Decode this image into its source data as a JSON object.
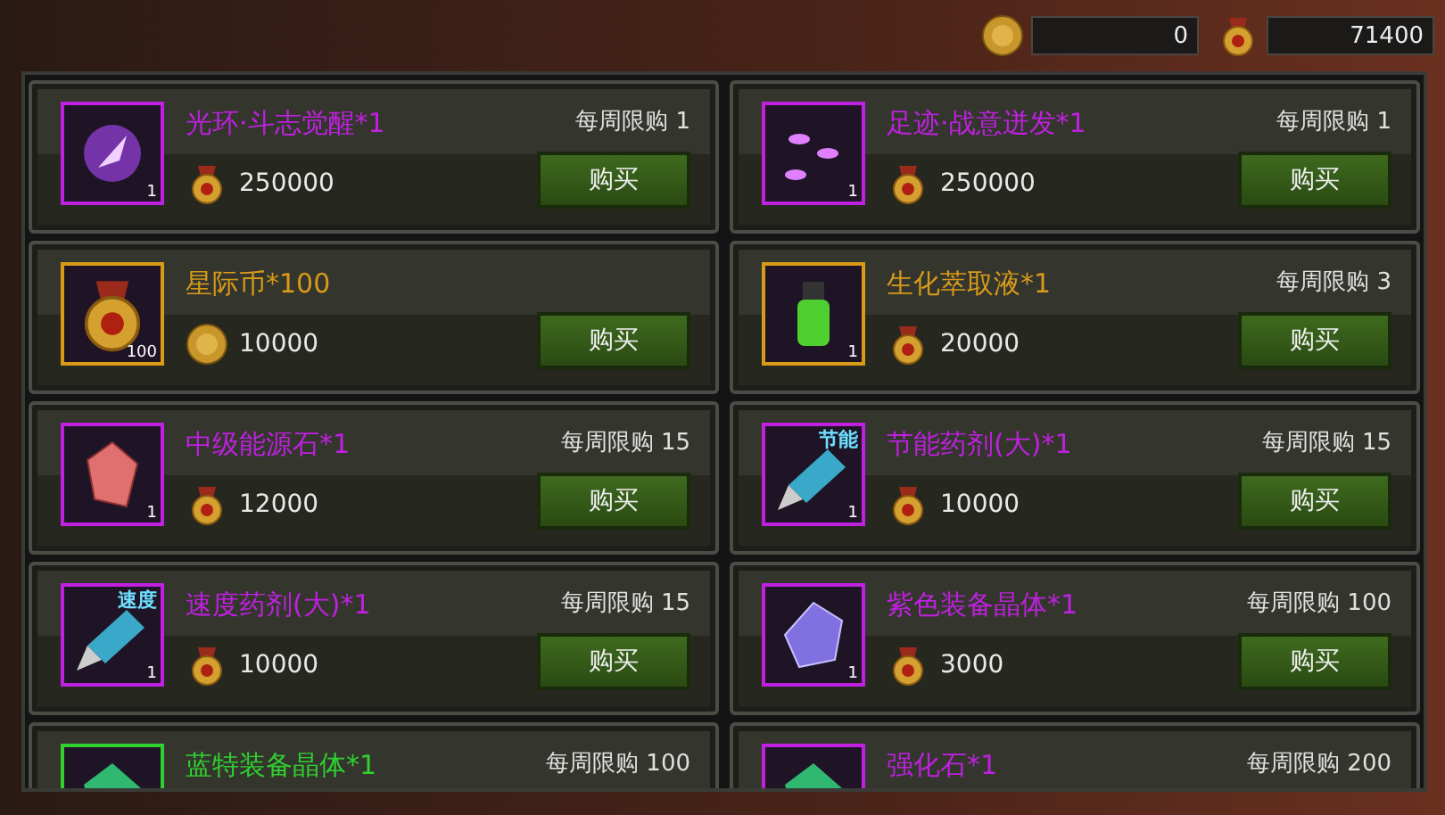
{
  "currencies": [
    {
      "kind": "coin",
      "value": "0"
    },
    {
      "kind": "medal",
      "value": "71400"
    }
  ],
  "items": [
    {
      "name": "光环·斗志觉醒*1",
      "color": "#c020e0",
      "kind": "aura",
      "qty": "1",
      "limit": "每周限购 1",
      "price": {
        "kind": "medal",
        "amount": "250000"
      },
      "button": "购买"
    },
    {
      "name": "足迹·战意迸发*1",
      "color": "#c020e0",
      "kind": "footprint",
      "qty": "1",
      "limit": "每周限购 1",
      "price": {
        "kind": "medal",
        "amount": "250000"
      },
      "button": "购买"
    },
    {
      "name": "星际币*100",
      "color": "#d89a18",
      "kind": "medal",
      "qty": "100",
      "price": {
        "kind": "coin",
        "amount": "10000"
      },
      "button": "购买"
    },
    {
      "name": "生化萃取液*1",
      "color": "#d89a18",
      "kind": "vial",
      "qty": "1",
      "limit": "每周限购 3",
      "price": {
        "kind": "medal",
        "amount": "20000"
      },
      "button": "购买"
    },
    {
      "name": "中级能源石*1",
      "color": "#c020e0",
      "kind": "redgem",
      "qty": "1",
      "limit": "每周限购 15",
      "price": {
        "kind": "medal",
        "amount": "12000"
      },
      "button": "购买"
    },
    {
      "name": "节能药剂(大)*1",
      "color": "#c020e0",
      "kind": "syringe",
      "icon_label": "节能",
      "qty": "1",
      "limit": "每周限购 15",
      "price": {
        "kind": "medal",
        "amount": "10000"
      },
      "button": "购买"
    },
    {
      "name": "速度药剂(大)*1",
      "color": "#c020e0",
      "kind": "syringe",
      "icon_label": "速度",
      "qty": "1",
      "limit": "每周限购 15",
      "price": {
        "kind": "medal",
        "amount": "10000"
      },
      "button": "购买"
    },
    {
      "name": "紫色装备晶体*1",
      "color": "#c020e0",
      "kind": "crystal",
      "qty": "1",
      "limit": "每周限购 100",
      "price": {
        "kind": "medal",
        "amount": "3000"
      },
      "button": "购买"
    },
    {
      "name": "蓝特装备晶体*1",
      "color": "#30d030",
      "kind": "greengem",
      "limit": "每周限购 100"
    },
    {
      "name": "强化石*1",
      "color": "#c020e0",
      "kind": "greengem",
      "limit": "每周限购 200"
    }
  ]
}
